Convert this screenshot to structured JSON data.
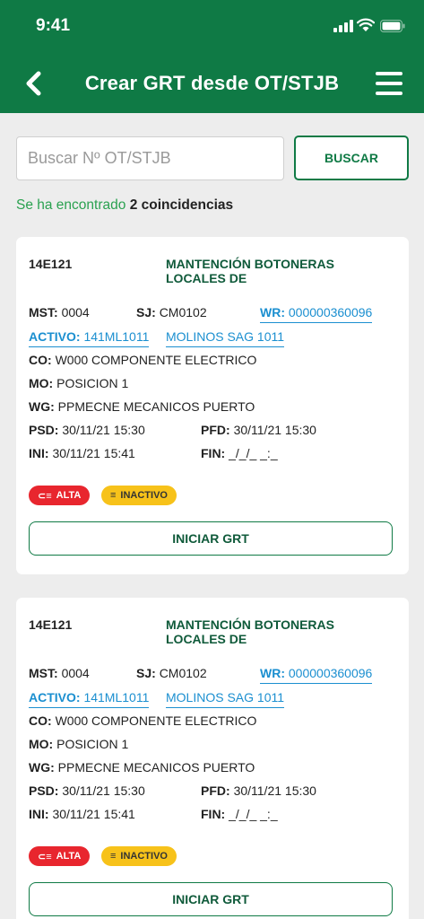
{
  "status_bar": {
    "time": "9:41"
  },
  "header": {
    "title": "Crear GRT desde OT/STJB"
  },
  "search": {
    "placeholder": "Buscar Nº OT/STJB",
    "button_label": "BUSCAR"
  },
  "result": {
    "prefix": "Se ha encontrado",
    "count_text": "2 coincidencias"
  },
  "colors": {
    "brand": "#0f7a45",
    "link": "#1b8fd0",
    "priority": "#e8262e",
    "status": "#f7c21a"
  },
  "cards": [
    {
      "code": "14E121",
      "title": "MANTENCIÓN BOTONERAS LOCALES DE",
      "mst_label": "MST:",
      "mst": "0004",
      "sj_label": "SJ:",
      "sj": "CM0102",
      "wr_label": "WR:",
      "wr": "000000360096",
      "activo_label": "ACTIVO:",
      "activo": "141ML1011",
      "location": "MOLINOS SAG 1011",
      "co_label": "CO:",
      "co": "W000 COMPONENTE ELECTRICO",
      "mo_label": "MO:",
      "mo": "POSICION 1",
      "wg_label": "WG:",
      "wg": "PPMECNE MECANICOS PUERTO",
      "psd_label": "PSD:",
      "psd": "30/11/21 15:30",
      "pfd_label": "PFD:",
      "pfd": "30/11/21 15:30",
      "ini_label": "INI:",
      "ini": "30/11/21 15:41",
      "fin_label": "FIN:",
      "fin": "_/_/_ _:_",
      "priority": "ALTA",
      "status": "INACTIVO",
      "button_label": "INICIAR GRT"
    },
    {
      "code": "14E121",
      "title": "MANTENCIÓN BOTONERAS LOCALES DE",
      "mst_label": "MST:",
      "mst": "0004",
      "sj_label": "SJ:",
      "sj": "CM0102",
      "wr_label": "WR:",
      "wr": "000000360096",
      "activo_label": "ACTIVO:",
      "activo": "141ML1011",
      "location": "MOLINOS SAG 1011",
      "co_label": "CO:",
      "co": "W000 COMPONENTE ELECTRICO",
      "mo_label": "MO:",
      "mo": "POSICION 1",
      "wg_label": "WG:",
      "wg": "PPMECNE MECANICOS PUERTO",
      "psd_label": "PSD:",
      "psd": "30/11/21 15:30",
      "pfd_label": "PFD:",
      "pfd": "30/11/21 15:30",
      "ini_label": "INI:",
      "ini": "30/11/21 15:41",
      "fin_label": "FIN:",
      "fin": "_/_/_ _:_",
      "priority": "ALTA",
      "status": "INACTIVO",
      "button_label": "INICIAR GRT"
    }
  ]
}
